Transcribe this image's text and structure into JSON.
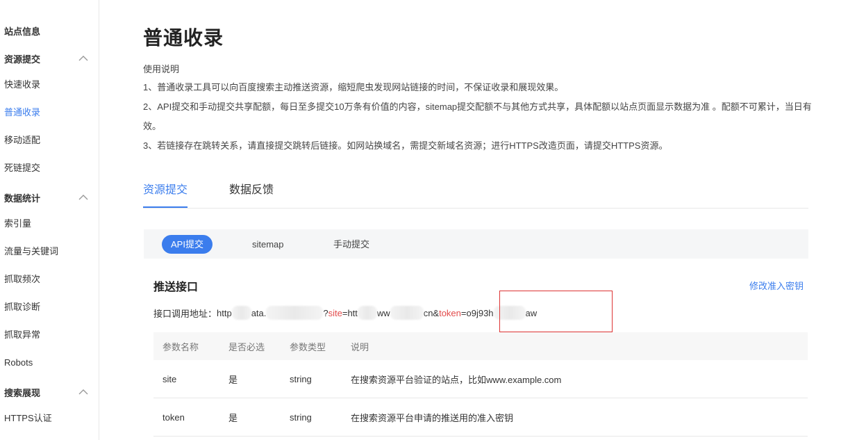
{
  "sidebar": {
    "site_info": "站点信息",
    "groups": {
      "resource_submit": "资源提交",
      "data_stats": "数据统计",
      "search_display": "搜索展现"
    },
    "items": {
      "fast_index": "快速收录",
      "normal_index": "普通收录",
      "mobile_adapt": "移动适配",
      "dead_link": "死链提交",
      "index_volume": "索引量",
      "traffic_keywords": "流量与关键词",
      "crawl_frequency": "抓取频次",
      "crawl_diagnosis": "抓取诊断",
      "crawl_errors": "抓取异常",
      "robots": "Robots",
      "https_cert": "HTTPS认证"
    }
  },
  "page": {
    "title": "普通收录",
    "instructions_heading": "使用说明",
    "instructions": [
      "1、普通收录工具可以向百度搜索主动推送资源，缩短爬虫发现网站链接的时间，不保证收录和展现效果。",
      "2、API提交和手动提交共享配额，每日至多提交10万条有价值的内容，sitemap提交配额不与其他方式共享，具体配额以站点页面显示数据为准 。配额不可累计，当日有效。",
      "3、若链接存在跳转关系，请直接提交跳转后链接。如网站换域名，需提交新域名资源；进行HTTPS改造页面，请提交HTTPS资源。"
    ]
  },
  "tabs": {
    "resource_submit": "资源提交",
    "data_feedback": "数据反馈"
  },
  "subtabs": {
    "api": "API提交",
    "sitemap": "sitemap",
    "manual": "手动提交"
  },
  "push": {
    "title": "推送接口",
    "edit_key": "修改准入密钥",
    "url_label": "接口调用地址：",
    "url_part1": "http",
    "url_part2": "ata.",
    "url_part3": "?",
    "url_site_kw": "site",
    "url_part4": "=htt",
    "url_part5": "ww",
    "url_part6": "cn&",
    "url_token_kw": "token",
    "url_part7": "=o9j93h",
    "url_part8": "aw"
  },
  "table": {
    "headers": {
      "name": "参数名称",
      "required": "是否必选",
      "type": "参数类型",
      "desc": "说明"
    },
    "rows": [
      {
        "name": "site",
        "required": "是",
        "type": "string",
        "desc": "在搜索资源平台验证的站点，比如www.example.com"
      },
      {
        "name": "token",
        "required": "是",
        "type": "string",
        "desc": "在搜索资源平台申请的推送用的准入密钥"
      }
    ]
  }
}
